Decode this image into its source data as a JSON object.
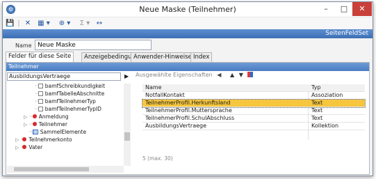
{
  "window": {
    "title": "Neue Maske (Teilnehmer)",
    "app_icon": "⚙",
    "minimize": "–",
    "maximize": "□",
    "close": "✕"
  },
  "toolbar": {
    "save_icon": "floppy-disk-icon",
    "delete_icon": "delete-x-icon",
    "items": [
      "💾",
      "|",
      "✕",
      "▦ ▾",
      "⊕ ▾",
      "Σ ▾",
      "↔"
    ]
  },
  "banner": {
    "label": "SeitenFeldSet"
  },
  "name_field": {
    "label": "Name",
    "value": "Neue Maske"
  },
  "tabs": [
    {
      "label": "Felder für diese Seite",
      "active": true
    },
    {
      "label": "Anzeigebedingung",
      "active": false
    },
    {
      "label": "Anwender-Hinweise",
      "active": false
    },
    {
      "label": "Index",
      "active": false
    }
  ],
  "panel": {
    "header": "Teilnehmer",
    "path_value": "AusbildungsVertraege",
    "arrow": "▶"
  },
  "tree": [
    {
      "label": "bamfSchreibkundigkeit",
      "kind": "checkbox",
      "indent": 3
    },
    {
      "label": "bamfTabelleAbschnitte",
      "kind": "checkbox",
      "indent": 3
    },
    {
      "label": "bamfTeilnehmerTyp",
      "kind": "checkbox",
      "indent": 3
    },
    {
      "label": "bamfTeilnehmerTypID",
      "kind": "checkbox",
      "indent": 3
    },
    {
      "label": "Anmeldung",
      "kind": "dot",
      "indent": 2
    },
    {
      "label": "Teilnehmer",
      "kind": "dot",
      "indent": 2
    },
    {
      "label": "SammelElemente",
      "kind": "table",
      "indent": 2
    },
    {
      "label": "Teilnehmerkonto",
      "kind": "dot",
      "indent": 1
    },
    {
      "label": "Vater",
      "kind": "dot",
      "indent": 1
    }
  ],
  "right": {
    "toolbar_label": "Ausgewählte Eigenschaften",
    "toolbar_arrow_left": "◀",
    "toolbar_up": "▲",
    "toolbar_down": "▼",
    "col_name": "Name",
    "col_typ": "Typ",
    "rows": [
      {
        "name": "NotfallKontakt",
        "typ": "Assoziation",
        "selected": false
      },
      {
        "name": "TeilnehmerProfil.Herkunftsland",
        "typ": "Text",
        "selected": true
      },
      {
        "name": "TeilnehmerProfil.Muttersprache",
        "typ": "Text",
        "selected": false
      },
      {
        "name": "TeilnehmerProfil.SchulAbschluss",
        "typ": "Text",
        "selected": false
      },
      {
        "name": "AusbildungsVertraege",
        "typ": "Kollektion",
        "selected": false
      }
    ],
    "count": "5 (max. 30)"
  }
}
